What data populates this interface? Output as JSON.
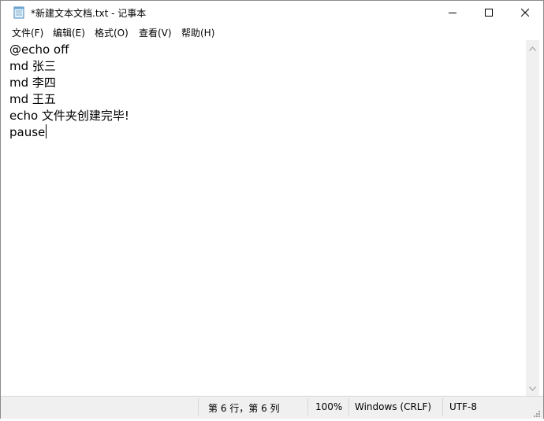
{
  "window": {
    "title": "*新建文本文档.txt - 记事本"
  },
  "menu": [
    {
      "label": "文件(F)"
    },
    {
      "label": "编辑(E)"
    },
    {
      "label": "格式(O)"
    },
    {
      "label": "查看(V)"
    },
    {
      "label": "帮助(H)"
    }
  ],
  "editor": {
    "lines": [
      "@echo off",
      "md 张三",
      "md 李四",
      "md 王五",
      "echo 文件夹创建完毕!",
      "pause"
    ]
  },
  "status": {
    "position": "第 6 行，第 6 列",
    "zoom": "100%",
    "line_ending": "Windows (CRLF)",
    "encoding": "UTF-8"
  },
  "colors": {
    "statusbar_bg": "#f0f0f0",
    "scrollbar_bg": "#f0f0f0",
    "text": "#000000"
  }
}
